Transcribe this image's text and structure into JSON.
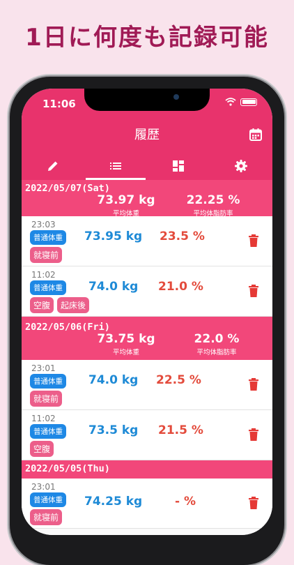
{
  "headline": "1日に何度も記録可能",
  "status": {
    "time": "11:06"
  },
  "header": {
    "title": "履歴"
  },
  "icons": {
    "calendar": "calendar-icon",
    "tabs": [
      "pencil-icon",
      "list-icon",
      "dashboard-icon",
      "gear-icon"
    ],
    "delete": "trash-icon"
  },
  "colors": {
    "bar": "#e8336c",
    "day_header": "#f2477a",
    "weight": "#1e8ad6",
    "fat": "#e34b3c",
    "badge": "#1e88e5",
    "tag": "#ec5e8a"
  },
  "days": [
    {
      "date": "2022/05/07(Sat)",
      "avg_weight": "73.97 kg",
      "avg_weight_label": "平均体重",
      "avg_fat": "22.25 %",
      "avg_fat_label": "平均体脂肪率",
      "entries": [
        {
          "time": "23:03",
          "type": "普通体重",
          "tags": [
            "就寝前"
          ],
          "weight": "73.95 kg",
          "fat": "23.5 %"
        },
        {
          "time": "11:02",
          "type": "普通体重",
          "tags": [
            "空腹",
            "起床後"
          ],
          "weight": "74.0 kg",
          "fat": "21.0 %"
        }
      ]
    },
    {
      "date": "2022/05/06(Fri)",
      "avg_weight": "73.75 kg",
      "avg_weight_label": "平均体重",
      "avg_fat": "22.0 %",
      "avg_fat_label": "平均体脂肪率",
      "entries": [
        {
          "time": "23:01",
          "type": "普通体重",
          "tags": [
            "就寝前"
          ],
          "weight": "74.0 kg",
          "fat": "22.5 %"
        },
        {
          "time": "11:02",
          "type": "普通体重",
          "tags": [
            "空腹"
          ],
          "weight": "73.5 kg",
          "fat": "21.5 %"
        }
      ]
    },
    {
      "date": "2022/05/05(Thu)",
      "entries": [
        {
          "time": "23:01",
          "type": "普通体重",
          "tags": [
            "就寝前"
          ],
          "weight": "74.25 kg",
          "fat": "- %"
        }
      ]
    }
  ]
}
